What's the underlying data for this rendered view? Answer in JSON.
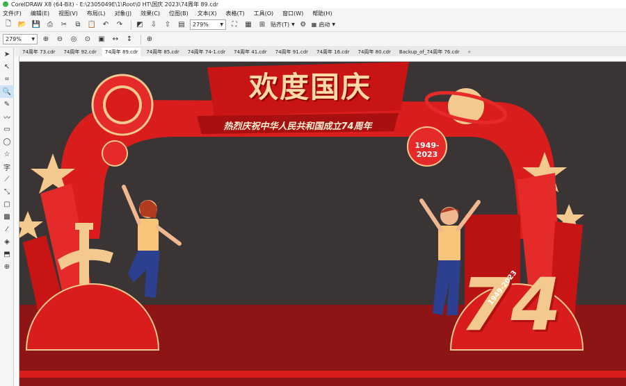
{
  "app": {
    "title": "CorelDRAW X8 (64-Bit) - E:\\2305049E\\1\\Root\\0 HT\\国庆 2023\\74周年 89.cdr"
  },
  "menu": [
    "文件(F)",
    "编辑(E)",
    "视图(V)",
    "布局(L)",
    "对象(J)",
    "效果(C)",
    "位图(B)",
    "文本(X)",
    "表格(T)",
    "工具(O)",
    "窗口(W)",
    "帮助(H)"
  ],
  "toolbar": {
    "zoom_value": "279%",
    "snap_label": "贴齐(T)",
    "launch_label": "启动"
  },
  "property_bar": {
    "zoom_value": "279%"
  },
  "tabs": [
    {
      "label": "74周年 73.cdr",
      "active": false
    },
    {
      "label": "74周年 92.cdr",
      "active": false
    },
    {
      "label": "74周年 89.cdr",
      "active": true
    },
    {
      "label": "74周年 85.cdr",
      "active": false
    },
    {
      "label": "74周年 74-1.cdr",
      "active": false
    },
    {
      "label": "74周年 41.cdr",
      "active": false
    },
    {
      "label": "74周年 91.cdr",
      "active": false
    },
    {
      "label": "74周年 16.cdr",
      "active": false
    },
    {
      "label": "74周年 80.cdr",
      "active": false
    },
    {
      "label": "Backup_of_74周年 76.cdr",
      "active": false
    }
  ],
  "artwork": {
    "headline": "欢度国庆",
    "subline": "热烈庆祝中华人民共和国成立74周年",
    "badge_years": "1949-2023",
    "big_number": "74",
    "number_years": "1949-2023"
  },
  "colors": {
    "canvas_bg": "#3b3434",
    "red": "#d91c1c",
    "dark_red": "#8d1515",
    "gold": "#f4c98f",
    "cream": "#fff1d6"
  }
}
